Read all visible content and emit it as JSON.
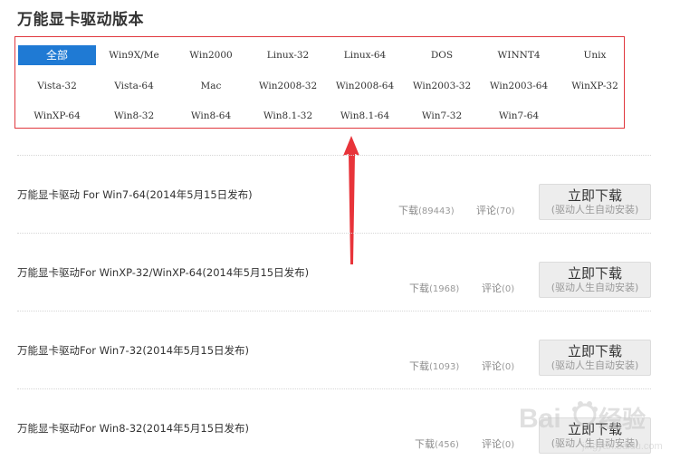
{
  "section_title": "万能显卡驱动版本",
  "os_filters": [
    [
      "全部",
      "Win9X/Me",
      "Win2000",
      "Linux-32",
      "Linux-64",
      "DOS",
      "WINNT4",
      "Unix"
    ],
    [
      "Vista-32",
      "Vista-64",
      "Mac",
      "Win2008-32",
      "Win2008-64",
      "Win2003-32",
      "Win2003-64",
      "WinXP-32"
    ],
    [
      "WinXP-64",
      "Win8-32",
      "Win8-64",
      "Win8.1-32",
      "Win8.1-64",
      "Win7-32",
      "Win7-64"
    ]
  ],
  "active_filter": "全部",
  "accent_color": "#1f7ad4",
  "highlight_color": "#e0383e",
  "drivers": [
    {
      "title": "万能显卡驱动 For Win7-64(2014年5月15日发布)",
      "download_label": "下载",
      "download_count": "(89443)",
      "comment_label": "评论",
      "comment_count": "(70)",
      "button_main": "立即下载",
      "button_sub": "(驱动人生自动安装)"
    },
    {
      "title": "万能显卡驱动For WinXP-32/WinXP-64(2014年5月15日发布)",
      "download_label": "下载",
      "download_count": "(1968)",
      "comment_label": "评论",
      "comment_count": "(0)",
      "button_main": "立即下载",
      "button_sub": "(驱动人生自动安装)"
    },
    {
      "title": "万能显卡驱动For Win7-32(2014年5月15日发布)",
      "download_label": "下载",
      "download_count": "(1093)",
      "comment_label": "评论",
      "comment_count": "(0)",
      "button_main": "立即下载",
      "button_sub": "(驱动人生自动安装)"
    },
    {
      "title": "万能显卡驱动For Win8-32(2014年5月15日发布)",
      "download_label": "下载",
      "download_count": "(456)",
      "comment_label": "评论",
      "comment_count": "(0)",
      "button_main": "立即下载",
      "button_sub": "(驱动人生自动安装)"
    }
  ],
  "watermark": {
    "logo": "Bai经验",
    "url": "jingyan.baidu.com"
  }
}
